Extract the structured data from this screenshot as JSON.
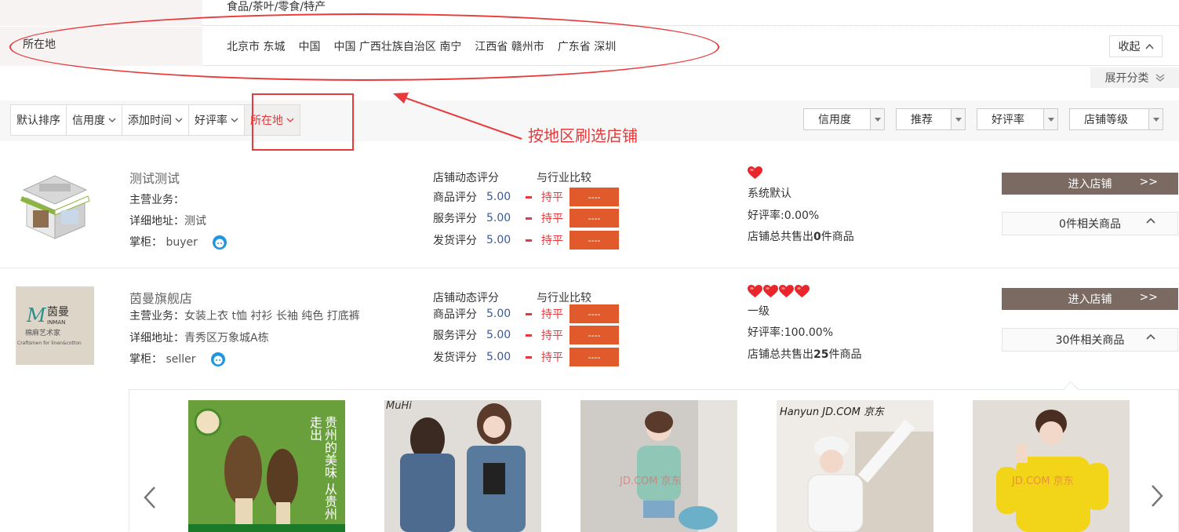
{
  "filters": {
    "category_values": "食品/茶叶/零食/特产",
    "location_label": "所在地",
    "locations": [
      "北京市 东城",
      "中国",
      "中国 广西壮族自治区 南宁",
      "江西省 赣州市",
      "广东省 深圳"
    ],
    "collapse_label": "收起",
    "expand_label": "展开分类"
  },
  "annotation": {
    "text": "按地区刷选店铺",
    "color": "#e8393b"
  },
  "sort": {
    "items": [
      "默认排序",
      "信用度",
      "添加时间",
      "好评率",
      "所在地"
    ],
    "active_index": 4,
    "selects": [
      "信用度",
      "推荐",
      "好评率",
      "店铺等级"
    ]
  },
  "shops": [
    {
      "name": "测试测试",
      "business_label": "主营业务：",
      "business": "",
      "address_label": "详细地址：",
      "address": "测试",
      "owner_label": "掌柜：",
      "owner": "buyer",
      "rating_head": "店铺动态评分",
      "compare_head": "与行业比较",
      "ratings": [
        {
          "label": "商品评分",
          "score": "5.00",
          "flat": "持平",
          "bar": "----"
        },
        {
          "label": "服务评分",
          "score": "5.00",
          "flat": "持平",
          "bar": "----"
        },
        {
          "label": "发货评分",
          "score": "5.00",
          "flat": "持平",
          "bar": "----"
        }
      ],
      "hearts": 1,
      "grade": "系统默认",
      "good_rate": "好评率:0.00%",
      "sold_prefix": "店铺总共售出",
      "sold_count": "0",
      "sold_suffix": "件商品",
      "enter_label": "进入店铺",
      "enter_arrow": ">>",
      "related": "0件相关商品"
    },
    {
      "name": "茵曼旗舰店",
      "business_label": "主营业务：",
      "business": "女装上衣 t恤 衬衫 长袖 纯色 打底裤",
      "address_label": "详细地址：",
      "address": "青秀区万象城A栋",
      "owner_label": "掌柜：",
      "owner": "seller",
      "rating_head": "店铺动态评分",
      "compare_head": "与行业比较",
      "ratings": [
        {
          "label": "商品评分",
          "score": "5.00",
          "flat": "持平",
          "bar": "----"
        },
        {
          "label": "服务评分",
          "score": "5.00",
          "flat": "持平",
          "bar": "----"
        },
        {
          "label": "发货评分",
          "score": "5.00",
          "flat": "持平",
          "bar": "----"
        }
      ],
      "hearts": 4,
      "grade": "一级",
      "good_rate": "好评率:100.00%",
      "sold_prefix": "店铺总共售出",
      "sold_count": "25",
      "sold_suffix": "件商品",
      "enter_label": "进入店铺",
      "enter_arrow": ">>",
      "related": "30件相关商品",
      "logo_brand": "茵曼",
      "logo_en": "INMAN",
      "logo_sub": "棉麻艺术家",
      "logo_tag": "Craftsmen for linen&cotton"
    }
  ],
  "products": [
    {
      "caption": "贵州的美味 从贵州走出"
    },
    {
      "caption": "MuHi"
    },
    {
      "caption": "JD.COM 京东"
    },
    {
      "caption": "Hanyun JD.COM 京东"
    },
    {
      "caption": "JD.COM 京东"
    }
  ]
}
